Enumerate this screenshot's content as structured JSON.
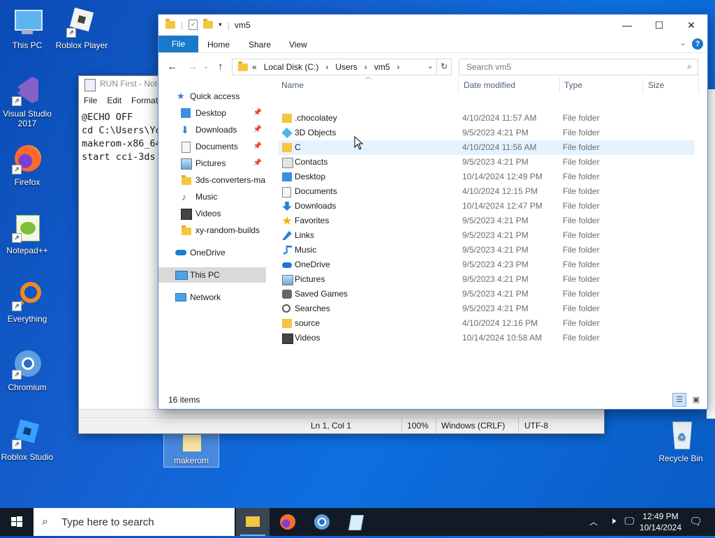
{
  "desktop_icons": [
    {
      "label": "This PC"
    },
    {
      "label": "Roblox Player"
    },
    {
      "label": "Visual Studio 2017"
    },
    {
      "label": "Firefox"
    },
    {
      "label": "Notepad++"
    },
    {
      "label": "Everything"
    },
    {
      "label": "Chromium"
    },
    {
      "label": "Roblox Studio"
    },
    {
      "label": "makerom"
    },
    {
      "label": "Recycle Bin"
    }
  ],
  "notepad": {
    "title": "RUN First - Note",
    "menu": [
      "File",
      "Edit",
      "Format"
    ],
    "lines": [
      "@ECHO OFF",
      "cd C:\\Users\\Yo",
      "makerom-x86_64",
      "start cci-3ds."
    ],
    "status": {
      "position": "Ln 1, Col 1",
      "zoom": "100%",
      "line_ending": "Windows (CRLF)",
      "encoding": "UTF-8"
    }
  },
  "explorer": {
    "title": "vm5",
    "ribbon_tabs": [
      "File",
      "Home",
      "Share",
      "View"
    ],
    "help": "?",
    "breadcrumb": [
      "«",
      "Local Disk (C:)",
      "›",
      "Users",
      "›",
      "vm5",
      "›"
    ],
    "search_placeholder": "Search vm5",
    "nav": [
      {
        "label": "Quick access",
        "pinned": false
      },
      {
        "label": "Desktop",
        "pinned": true
      },
      {
        "label": "Downloads",
        "pinned": true
      },
      {
        "label": "Documents",
        "pinned": true
      },
      {
        "label": "Pictures",
        "pinned": true
      },
      {
        "label": "3ds-converters-ma",
        "pinned": false
      },
      {
        "label": "Music",
        "pinned": false
      },
      {
        "label": "Videos",
        "pinned": false
      },
      {
        "label": "xy-random-builds",
        "pinned": false
      },
      {
        "label": "OneDrive",
        "pinned": false
      },
      {
        "label": "This PC",
        "pinned": false
      },
      {
        "label": "Network",
        "pinned": false
      }
    ],
    "columns": [
      "Name",
      "Date modified",
      "Type",
      "Size"
    ],
    "files": [
      {
        "name": ".chocolatey",
        "date": "4/10/2024 11:57 AM",
        "type": "File folder",
        "icon": "folder-icon"
      },
      {
        "name": "3D Objects",
        "date": "9/5/2023 4:21 PM",
        "type": "File folder",
        "icon": "3d-objects-icon"
      },
      {
        "name": "C",
        "date": "4/10/2024 11:56 AM",
        "type": "File folder",
        "icon": "folder-icon"
      },
      {
        "name": "Contacts",
        "date": "9/5/2023 4:21 PM",
        "type": "File folder",
        "icon": "contacts-icon"
      },
      {
        "name": "Desktop",
        "date": "10/14/2024 12:49 PM",
        "type": "File folder",
        "icon": "desktop-icon"
      },
      {
        "name": "Documents",
        "date": "4/10/2024 12:15 PM",
        "type": "File folder",
        "icon": "documents-icon"
      },
      {
        "name": "Downloads",
        "date": "10/14/2024 12:47 PM",
        "type": "File folder",
        "icon": "downloads-icon"
      },
      {
        "name": "Favorites",
        "date": "9/5/2023 4:21 PM",
        "type": "File folder",
        "icon": "star-icon"
      },
      {
        "name": "Links",
        "date": "9/5/2023 4:21 PM",
        "type": "File folder",
        "icon": "links-icon"
      },
      {
        "name": "Music",
        "date": "9/5/2023 4:21 PM",
        "type": "File folder",
        "icon": "music-icon"
      },
      {
        "name": "OneDrive",
        "date": "9/5/2023 4:23 PM",
        "type": "File folder",
        "icon": "onedrive-icon"
      },
      {
        "name": "Pictures",
        "date": "9/5/2023 4:21 PM",
        "type": "File folder",
        "icon": "pictures-icon"
      },
      {
        "name": "Saved Games",
        "date": "9/5/2023 4:21 PM",
        "type": "File folder",
        "icon": "saved-games-icon"
      },
      {
        "name": "Searches",
        "date": "9/5/2023 4:21 PM",
        "type": "File folder",
        "icon": "searches-icon"
      },
      {
        "name": "source",
        "date": "4/10/2024 12:16 PM",
        "type": "File folder",
        "icon": "folder-icon"
      },
      {
        "name": "Videos",
        "date": "10/14/2024 10:58 AM",
        "type": "File folder",
        "icon": "videos-icon"
      }
    ],
    "status": "16 items"
  },
  "taskbar": {
    "search_placeholder": "Type here to search",
    "time": "12:49 PM",
    "date": "10/14/2024"
  },
  "colors": {
    "accent": "#1979ca",
    "folder": "#f5c542",
    "taskbar": "#111a25"
  }
}
